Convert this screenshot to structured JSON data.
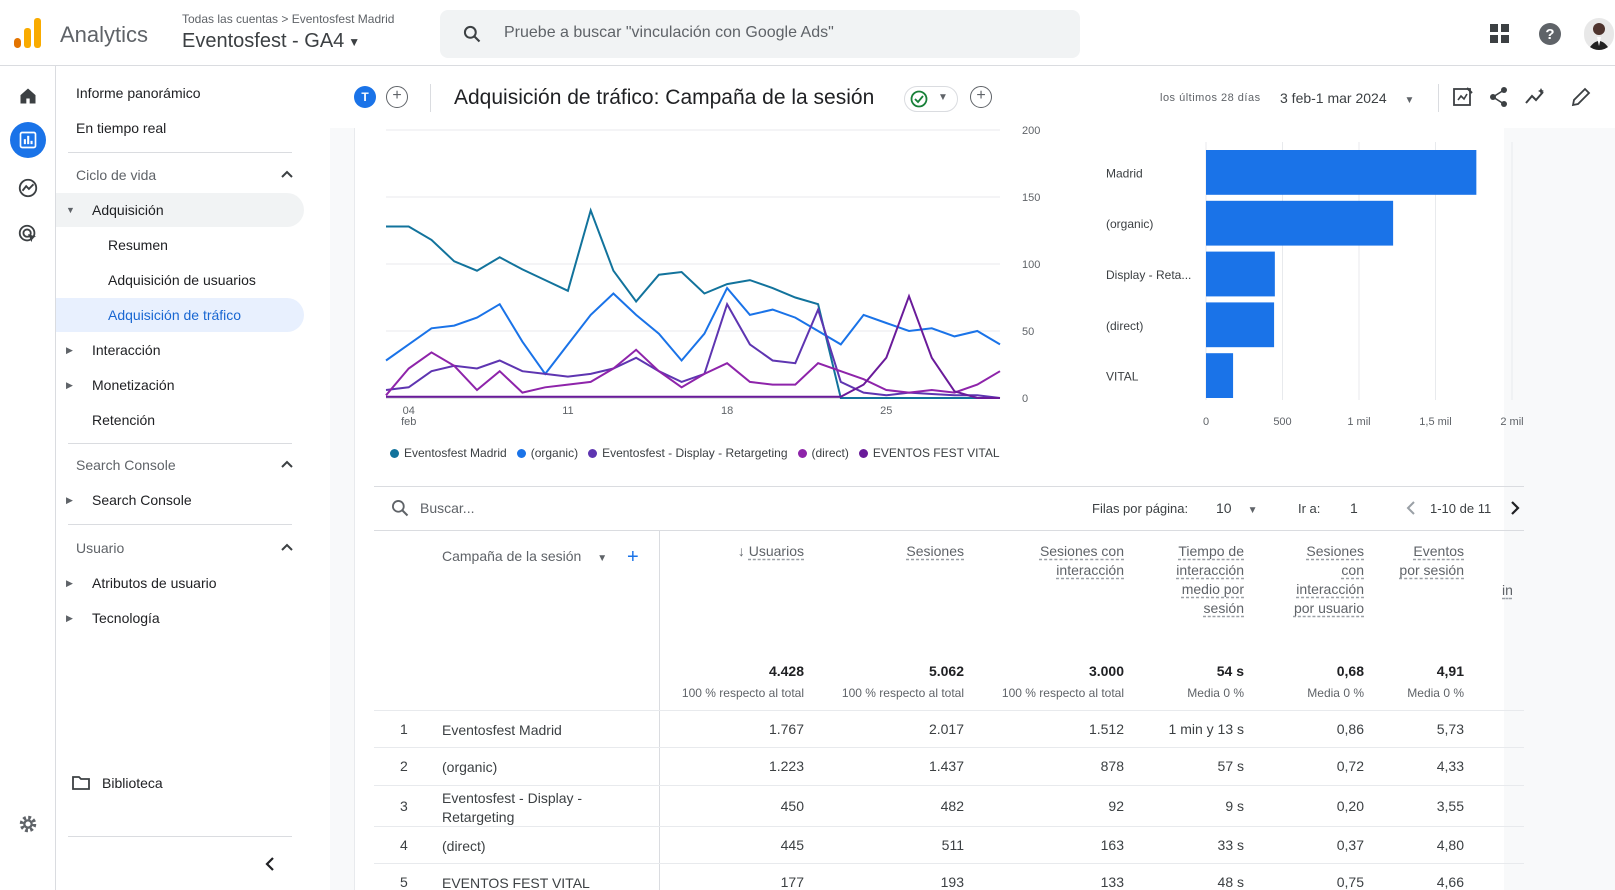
{
  "header": {
    "app_name": "Analytics",
    "account_crumb": "Todas las cuentas > Eventosfest Madrid",
    "property": "Eventosfest - GA4",
    "search_placeholder": "Pruebe a buscar \"vinculación con Google Ads\""
  },
  "sidebar": {
    "top_items": [
      "Informe panorámico",
      "En tiempo real"
    ],
    "lifecycle_title": "Ciclo de vida",
    "acquisition": "Adquisición",
    "acq_items": [
      "Resumen",
      "Adquisición de usuarios",
      "Adquisición de tráfico"
    ],
    "lifecycle_items": [
      "Interacción",
      "Monetización",
      "Retención"
    ],
    "search_console_title": "Search Console",
    "search_console_item": "Search Console",
    "user_title": "Usuario",
    "user_items": [
      "Atributos de usuario",
      "Tecnología"
    ],
    "library": "Biblioteca"
  },
  "report": {
    "comparison_badge": "T",
    "title": "Adquisición de tráfico: Campaña de la sesión",
    "date_label": "los últimos 28 días",
    "date_range": "3 feb-1 mar 2024"
  },
  "chart_data": [
    {
      "type": "line",
      "x": [
        "03 feb",
        "04 feb",
        "05 feb",
        "06 feb",
        "07 feb",
        "08 feb",
        "09 feb",
        "10 feb",
        "11 feb",
        "12 feb",
        "13 feb",
        "14 feb",
        "15 feb",
        "16 feb",
        "17 feb",
        "18 feb",
        "19 feb",
        "20 feb",
        "21 feb",
        "22 feb",
        "23 feb",
        "24 feb",
        "25 feb",
        "26 feb",
        "27 feb",
        "28 feb",
        "29 feb",
        "01 mar"
      ],
      "x_tick_labels": [
        "04\nfeb",
        "11",
        "18",
        "25"
      ],
      "y_ticks": [
        0,
        50,
        100,
        150,
        200
      ],
      "ylim": [
        0,
        200
      ],
      "series": [
        {
          "name": "Eventosfest Madrid",
          "color": "#12739c",
          "values": [
            128,
            128,
            118,
            102,
            95,
            105,
            96,
            88,
            80,
            140,
            95,
            72,
            92,
            94,
            78,
            85,
            88,
            82,
            75,
            70,
            0,
            0,
            0,
            0,
            0,
            0,
            0,
            0
          ]
        },
        {
          "name": "(organic)",
          "color": "#1a73e8",
          "values": [
            28,
            40,
            52,
            54,
            60,
            70,
            42,
            18,
            40,
            62,
            78,
            62,
            48,
            28,
            48,
            82,
            62,
            66,
            60,
            50,
            40,
            62,
            56,
            50,
            52,
            46,
            50,
            40
          ]
        },
        {
          "name": "Eventosfest - Display - Retargeting",
          "color": "#5e35b1",
          "values": [
            6,
            8,
            20,
            24,
            22,
            28,
            20,
            18,
            16,
            18,
            22,
            30,
            20,
            12,
            18,
            70,
            40,
            28,
            26,
            66,
            12,
            4,
            2,
            4,
            3,
            2,
            2,
            0
          ]
        },
        {
          "name": "(direct)",
          "color": "#8e24aa",
          "values": [
            2,
            22,
            34,
            24,
            6,
            20,
            4,
            8,
            10,
            12,
            22,
            36,
            20,
            8,
            18,
            26,
            12,
            10,
            10,
            26,
            20,
            14,
            6,
            4,
            6,
            4,
            10,
            20
          ]
        },
        {
          "name": "EVENTOS FEST VITAL",
          "color": "#6a1b9a",
          "values": [
            1,
            1,
            1,
            1,
            1,
            1,
            1,
            1,
            1,
            1,
            1,
            1,
            1,
            1,
            1,
            1,
            1,
            1,
            1,
            1,
            1,
            10,
            30,
            76,
            30,
            5,
            0,
            0
          ]
        }
      ]
    },
    {
      "type": "bar",
      "orientation": "horizontal",
      "categories": [
        "Madrid",
        "(organic)",
        "Display - Reta...",
        "(direct)",
        "VITAL"
      ],
      "values": [
        1767,
        1223,
        450,
        445,
        177
      ],
      "x_ticks": [
        0,
        500,
        1000,
        1500,
        2000
      ],
      "x_tick_labels": [
        "0",
        "500",
        "1 mil",
        "1,5 mil",
        "2 mil"
      ],
      "xlim": [
        0,
        2000
      ],
      "color": "#1a73e8"
    }
  ],
  "table": {
    "search_placeholder": "Buscar...",
    "rows_per_page_label": "Filas por página:",
    "rows_per_page": "10",
    "goto_label": "Ir a:",
    "goto_value": "1",
    "pagination": "1-10 de 11",
    "dimension_header": "Campaña de la sesión",
    "columns": [
      "Usuarios",
      "Sesiones",
      "Sesiones con interacción",
      "Tiempo de interacción medio por sesión",
      "Sesiones con interacción por usuario",
      "Eventos por sesión",
      "in"
    ],
    "totals": [
      "4.428",
      "5.062",
      "3.000",
      "54 s",
      "0,68",
      "4,91"
    ],
    "totals_sub": [
      "100 % respecto al total",
      "100 % respecto al total",
      "100 % respecto al total",
      "Media 0 %",
      "Media 0 %",
      "Media 0 %"
    ],
    "rows": [
      {
        "n": "1",
        "name": "Eventosfest Madrid",
        "vals": [
          "1.767",
          "2.017",
          "1.512",
          "1 min y 13 s",
          "0,86",
          "5,73"
        ]
      },
      {
        "n": "2",
        "name": "(organic)",
        "vals": [
          "1.223",
          "1.437",
          "878",
          "57 s",
          "0,72",
          "4,33"
        ]
      },
      {
        "n": "3",
        "name": "Eventosfest - Display - Retargeting",
        "vals": [
          "450",
          "482",
          "92",
          "9 s",
          "0,20",
          "3,55"
        ]
      },
      {
        "n": "4",
        "name": "(direct)",
        "vals": [
          "445",
          "511",
          "163",
          "33 s",
          "0,37",
          "4,80"
        ]
      },
      {
        "n": "5",
        "name": "EVENTOS FEST VITAL",
        "vals": [
          "177",
          "193",
          "133",
          "48 s",
          "0,75",
          "4,66"
        ]
      }
    ]
  }
}
